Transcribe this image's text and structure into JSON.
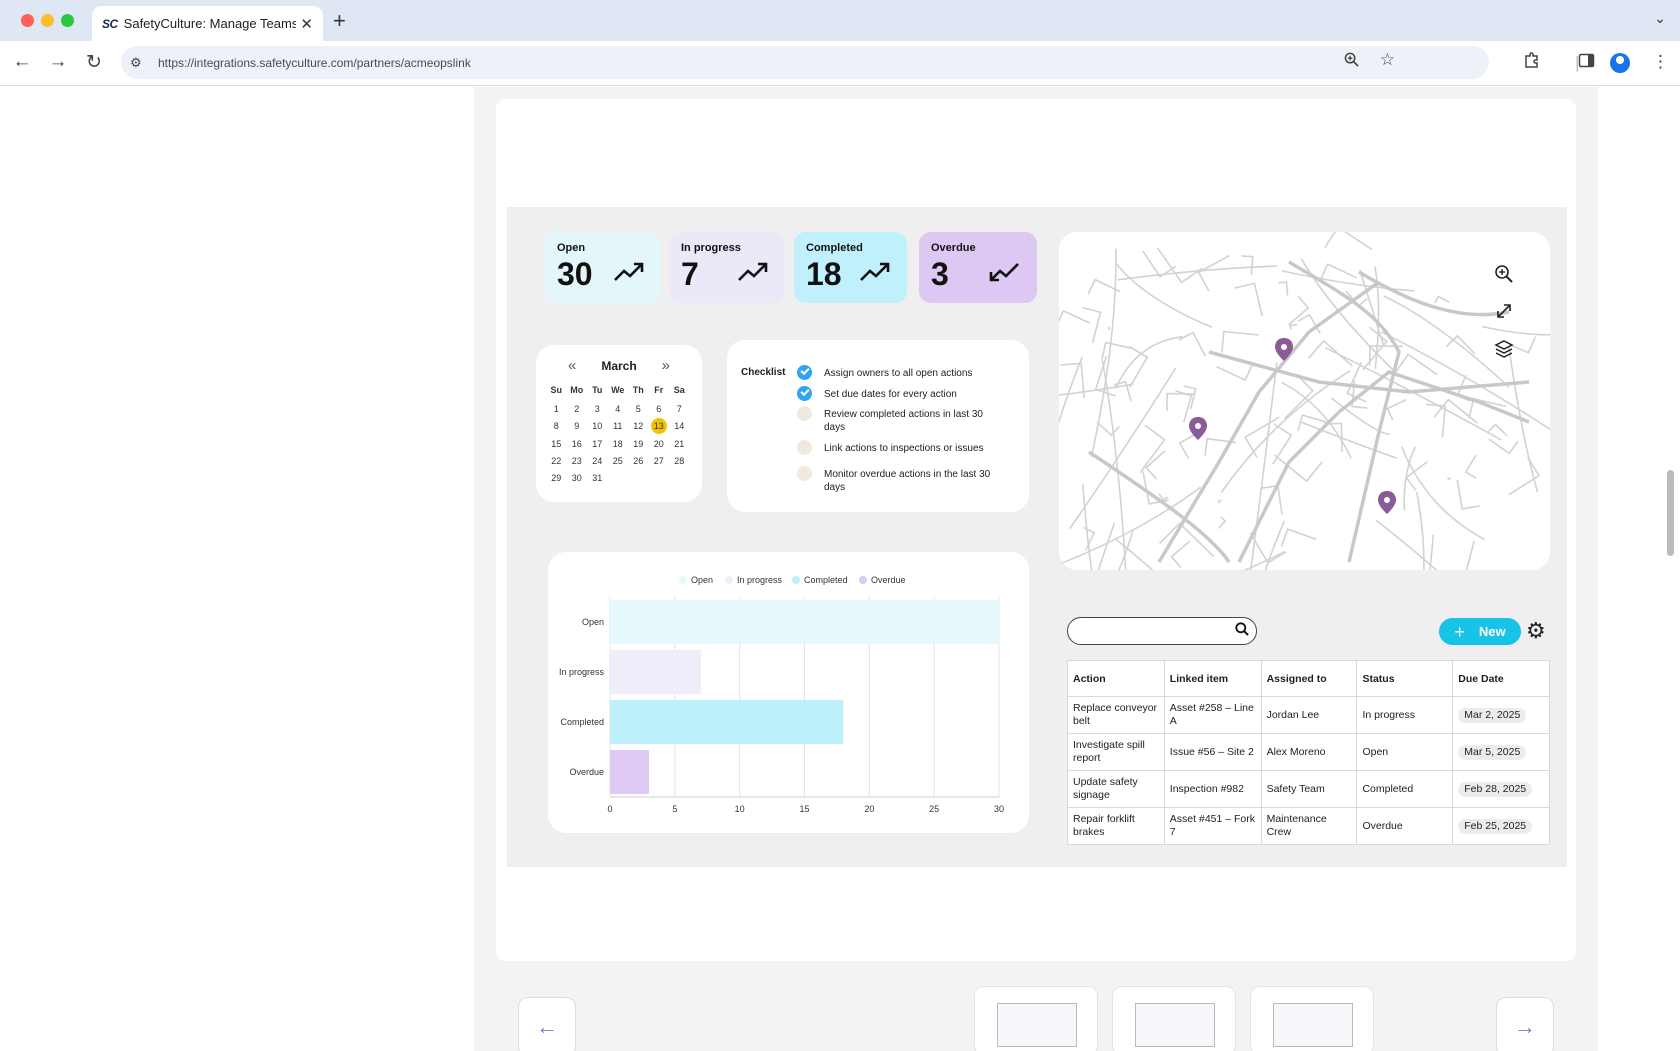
{
  "browser": {
    "tab_title": "SafetyCulture: Manage Teams and...",
    "favicon_text": "SC",
    "url": "https://integrations.safetyculture.com/partners/acmeopslink"
  },
  "stats": [
    {
      "label": "Open",
      "value": "30",
      "color": "#e3f7fb"
    },
    {
      "label": "In progress",
      "value": "7",
      "color": "#ece8f8"
    },
    {
      "label": "Completed",
      "value": "18",
      "color": "#bff0fb"
    },
    {
      "label": "Overdue",
      "value": "3",
      "color": "#dcc8f2"
    }
  ],
  "calendar": {
    "month": "March",
    "days_of_week": [
      "Su",
      "Mo",
      "Tu",
      "We",
      "Th",
      "Fr",
      "Sa"
    ],
    "days": [
      "1",
      "2",
      "3",
      "4",
      "5",
      "6",
      "7",
      "8",
      "9",
      "10",
      "11",
      "12",
      "13",
      "14",
      "15",
      "16",
      "17",
      "18",
      "19",
      "20",
      "21",
      "22",
      "23",
      "24",
      "25",
      "26",
      "27",
      "28",
      "29",
      "30",
      "31"
    ],
    "today": "13"
  },
  "checklist": {
    "title": "Checklist",
    "items": [
      {
        "text": "Assign owners to all open actions",
        "done": true
      },
      {
        "text": "Set due dates for every action",
        "done": true
      },
      {
        "text": "Review completed actions in last 30 days",
        "done": false
      },
      {
        "text": "Link actions to inspections or issues",
        "done": false
      },
      {
        "text": "Monitor overdue actions in the last 30 days",
        "done": false
      }
    ]
  },
  "chart_data": {
    "type": "bar",
    "orientation": "horizontal",
    "categories": [
      "Open",
      "In progress",
      "Completed",
      "Overdue"
    ],
    "values": [
      30,
      7,
      18,
      3
    ],
    "colors": [
      "#e6f8fc",
      "#efedfa",
      "#bdf0fb",
      "#ddc9f3"
    ],
    "legend": [
      "Open",
      "In progress",
      "Completed",
      "Overdue"
    ],
    "legend_position": "top",
    "xlim": [
      0,
      30
    ],
    "xticks": [
      "0",
      "5",
      "10",
      "15",
      "20",
      "25",
      "30"
    ],
    "grid": true
  },
  "toolbar": {
    "new_label": "New"
  },
  "table": {
    "headers": [
      "Action",
      "Linked item",
      "Assigned to",
      "Status",
      "Due Date"
    ],
    "rows": [
      [
        "Replace conveyor belt",
        "Asset #258 – Line A",
        "Jordan Lee",
        "In progress",
        "Mar 2, 2025"
      ],
      [
        "Investigate spill report",
        "Issue #56 – Site 2",
        "Alex Moreno",
        "Open",
        "Mar 5, 2025"
      ],
      [
        "Update safety signage",
        "Inspection #982",
        "Safety Team",
        "Completed",
        "Feb 28, 2025"
      ],
      [
        "Repair forklift brakes",
        "Asset #451 – Fork 7",
        "Maintenance Crew",
        "Overdue",
        "Feb 25, 2025"
      ]
    ]
  }
}
